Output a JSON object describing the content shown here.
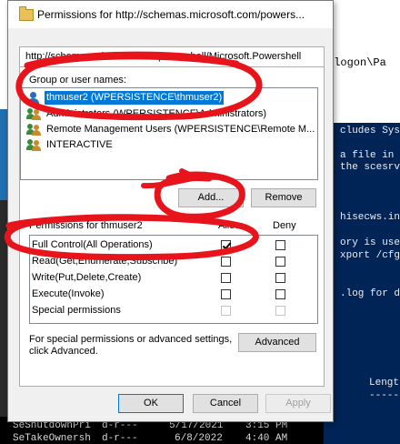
{
  "dialog": {
    "title": "Permissions for http://schemas.microsoft.com/powers...",
    "tab_label": "http://schemas.microsoft.com/powershell/Microsoft.Powershell",
    "group_label": "Group or user names:",
    "users": [
      {
        "name": "thmuser2 (WPERSISTENCE\\thmuser2)",
        "icon": "user-icon",
        "selected": true
      },
      {
        "name": "Administrators (WPERSISTENCE\\Administrators)",
        "icon": "group-icon",
        "selected": false
      },
      {
        "name": "Remote Management Users (WPERSISTENCE\\Remote M...",
        "icon": "group-icon",
        "selected": false
      },
      {
        "name": "INTERACTIVE",
        "icon": "group-icon",
        "selected": false
      }
    ],
    "add_label": "Add...",
    "remove_label": "Remove",
    "permissions_label": "Permissions for thmuser2",
    "allow_label": "Allow",
    "deny_label": "Deny",
    "permissions": [
      {
        "name": "Full Control(All Operations)",
        "allow": true,
        "deny": false,
        "disabled": false
      },
      {
        "name": "Read(Get,Enumerate,Subscribe)",
        "allow": false,
        "deny": false,
        "disabled": false
      },
      {
        "name": "Write(Put,Delete,Create)",
        "allow": false,
        "deny": false,
        "disabled": false
      },
      {
        "name": "Execute(Invoke)",
        "allow": false,
        "deny": false,
        "disabled": false
      },
      {
        "name": "Special permissions",
        "allow": false,
        "deny": false,
        "disabled": true
      }
    ],
    "special_text_1": "For special permissions or advanced settings,",
    "special_text_2": "click Advanced.",
    "advanced_label": "Advanced",
    "ok_label": "OK",
    "cancel_label": "Cancel",
    "apply_label": "Apply"
  },
  "background": {
    "console_top_text": "tlogon\\Pa",
    "console_lines": [
      "cludes Sys",
      "a file in",
      "the scesrv",
      "hisecws.in",
      "ory is use",
      "xport /cfg",
      ".log for d",
      "Lengt",
      "-----"
    ],
    "bottom_lines": [
      {
        "left": "SeShutdownPri",
        "mid": "d-r---",
        "date": "5/17/2021",
        "time": "3:15 PM"
      },
      {
        "left": "SeTakeOwnersh",
        "mid": "d-r---",
        "date": "6/8/2022",
        "time": "4:40 AM"
      }
    ]
  },
  "colors": {
    "selection": "#0078d7",
    "console_bg": "#012456",
    "annotation_red": "#e8141c"
  }
}
